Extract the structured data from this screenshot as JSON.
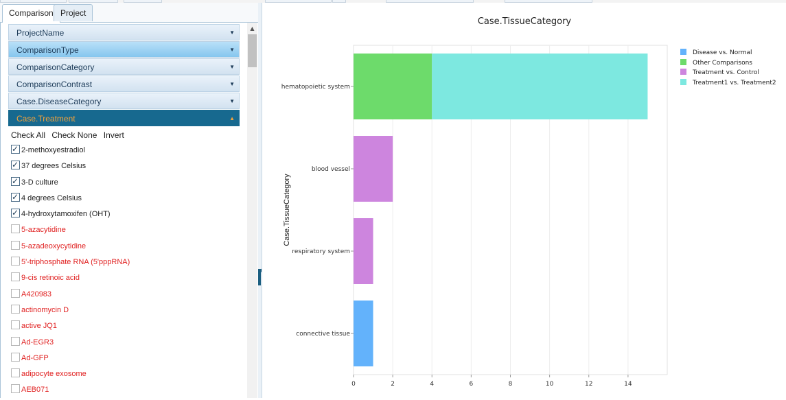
{
  "tabs": [
    {
      "label": "Comparison"
    },
    {
      "label": "Project"
    }
  ],
  "accordion": [
    {
      "label": "ProjectName"
    },
    {
      "label": "ComparisonType"
    },
    {
      "label": "ComparisonCategory"
    },
    {
      "label": "ComparisonContrast"
    },
    {
      "label": "Case.DiseaseCategory"
    },
    {
      "label": "Case.Treatment"
    }
  ],
  "check_controls": {
    "check_all": "Check All",
    "check_none": "Check None",
    "invert": "Invert"
  },
  "treatments": [
    {
      "label": "2-methoxyestradiol",
      "checked": true
    },
    {
      "label": "37 degrees Celsius",
      "checked": true
    },
    {
      "label": "3-D culture",
      "checked": true
    },
    {
      "label": "4 degrees Celsius",
      "checked": true
    },
    {
      "label": "4-hydroxytamoxifen (OHT)",
      "checked": true
    },
    {
      "label": "5-azacytidine",
      "checked": false
    },
    {
      "label": "5-azadeoxycytidine",
      "checked": false
    },
    {
      "label": "5'-triphosphate RNA (5'pppRNA)",
      "checked": false
    },
    {
      "label": "9-cis retinoic acid",
      "checked": false
    },
    {
      "label": "A420983",
      "checked": false
    },
    {
      "label": "actinomycin D",
      "checked": false
    },
    {
      "label": "active JQ1",
      "checked": false
    },
    {
      "label": "Ad-EGR3",
      "checked": false
    },
    {
      "label": "Ad-GFP",
      "checked": false
    },
    {
      "label": "adipocyte exosome",
      "checked": false
    },
    {
      "label": "AEB071",
      "checked": false
    }
  ],
  "chart_data": {
    "type": "bar",
    "orientation": "horizontal",
    "stacked": true,
    "title": "Case.TissueCategory",
    "xlabel": "",
    "ylabel": "Case.TissueCategory",
    "xlim": [
      0,
      16
    ],
    "xticks": [
      0,
      2,
      4,
      6,
      8,
      10,
      12,
      14
    ],
    "categories": [
      "hematopoietic system",
      "blood vessel",
      "respiratory system",
      "connective tissue"
    ],
    "series": [
      {
        "name": "Disease vs. Normal",
        "color": "#63b2fb",
        "values": [
          0,
          0,
          0,
          1
        ]
      },
      {
        "name": "Other Comparisons",
        "color": "#6ddb6b",
        "values": [
          4,
          0,
          0,
          0
        ]
      },
      {
        "name": "Treatment vs. Control",
        "color": "#cd85de",
        "values": [
          0,
          2,
          1,
          0
        ]
      },
      {
        "name": "Treatment1 vs. Treatment2",
        "color": "#7de8e0",
        "values": [
          11,
          0,
          0,
          0
        ]
      }
    ],
    "grid": true,
    "legend_position": "right"
  }
}
